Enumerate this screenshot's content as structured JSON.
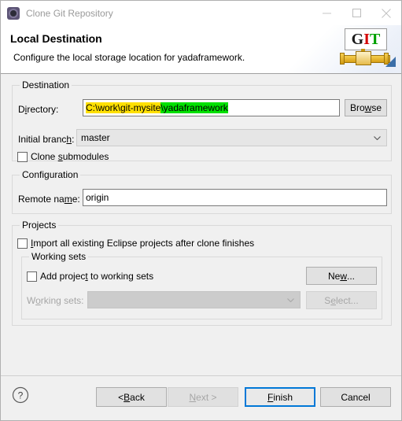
{
  "window": {
    "title": "Clone Git Repository",
    "icon": "git-repo-icon",
    "minimize_label": "—",
    "maximize_label": "□",
    "close_label": "✕"
  },
  "header": {
    "title": "Local Destination",
    "subtitle": "Configure the local storage location for yadaframework.",
    "logo": {
      "g": "G",
      "i": "I",
      "t": "T",
      "colors": {
        "g": "#1a1a1a",
        "i": "#d40000",
        "t": "#00a000",
        "pipe": "#e6bb4a"
      }
    }
  },
  "destination": {
    "group_label": "Destination",
    "directory": {
      "label_pre": "D",
      "label_mnemonic": "i",
      "label_post": "rectory:",
      "value_highlight_yellow": "C:\\work\\git-mysite",
      "value_highlight_green": "\\yadaframework",
      "highlight_colors": {
        "yellow": "#ffe000",
        "green": "#00e000"
      }
    },
    "browse_button": {
      "pre": "Bro",
      "mnemonic": "w",
      "post": "se"
    },
    "initial_branch": {
      "label_pre": "Initial branc",
      "label_mnemonic": "h",
      "label_post": ":",
      "value": "master"
    },
    "clone_submodules": {
      "label_pre": "Clone ",
      "label_mnemonic": "s",
      "label_post": "ubmodules",
      "checked": false
    }
  },
  "configuration": {
    "group_label": "Configuration",
    "remote_name": {
      "label_pre": "Remote na",
      "label_mnemonic": "m",
      "label_post": "e:",
      "value": "origin"
    }
  },
  "projects": {
    "group_label": "Projects",
    "import_projects": {
      "label_pre": "",
      "label_mnemonic": "I",
      "label_post": "mport all existing Eclipse projects after clone finishes",
      "checked": false
    },
    "working_sets": {
      "group_label": "Working sets",
      "add_project": {
        "label_pre": "Add projec",
        "label_mnemonic": "t",
        "label_post": " to working sets",
        "checked": false
      },
      "new_button": {
        "pre": "Ne",
        "mnemonic": "w",
        "post": "..."
      },
      "sets_label": {
        "pre": "W",
        "mnemonic": "o",
        "post": "rking sets:"
      },
      "sets_value": "",
      "select_button": {
        "pre": "S",
        "mnemonic": "e",
        "post": "lect..."
      }
    }
  },
  "footer": {
    "help_icon": "help-question-icon",
    "back_button": {
      "pre": "< ",
      "mnemonic": "B",
      "post": "ack"
    },
    "next_button": {
      "pre": "",
      "mnemonic": "N",
      "post": "ext >"
    },
    "finish_button": {
      "pre": "",
      "mnemonic": "F",
      "post": "inish"
    },
    "cancel_button": {
      "pre": "Cancel",
      "mnemonic": "",
      "post": ""
    },
    "accent_color": "#0078d7"
  }
}
